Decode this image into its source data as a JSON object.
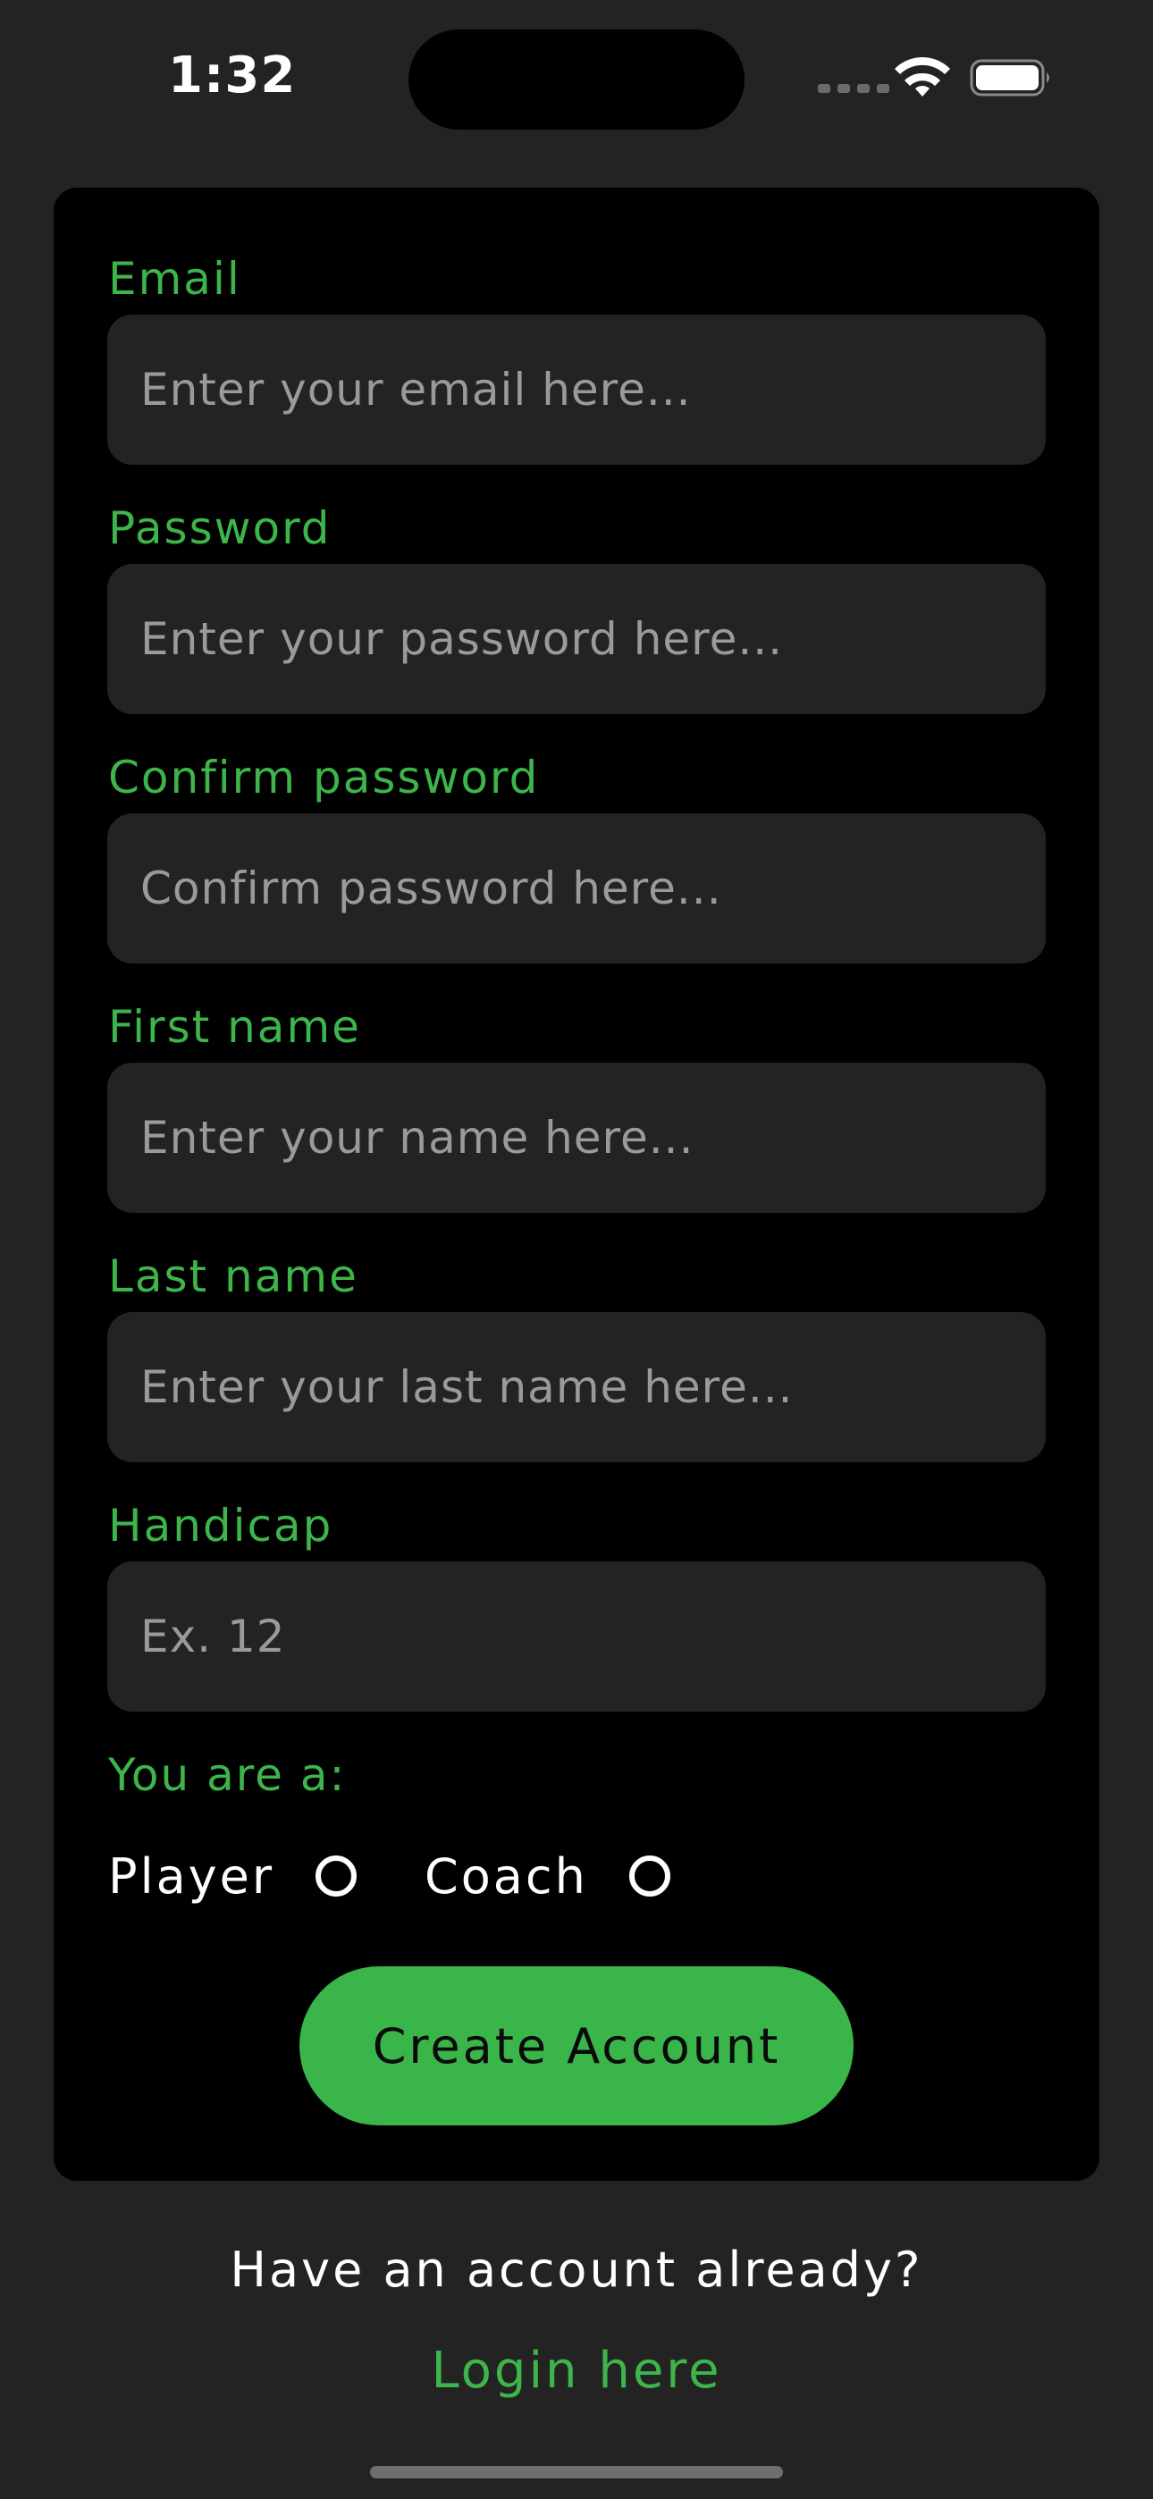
{
  "status_bar": {
    "time": "1:32"
  },
  "form": {
    "email": {
      "label": "Email",
      "placeholder": "Enter your email here...",
      "value": ""
    },
    "password": {
      "label": "Password",
      "placeholder": "Enter your password here...",
      "value": ""
    },
    "confirm_password": {
      "label": "Confirm password",
      "placeholder": "Confirm password here...",
      "value": ""
    },
    "first_name": {
      "label": "First name",
      "placeholder": "Enter your name here...",
      "value": ""
    },
    "last_name": {
      "label": "Last name",
      "placeholder": "Enter your last name here...",
      "value": ""
    },
    "handicap": {
      "label": "Handicap",
      "placeholder": "Ex. 12",
      "value": ""
    },
    "role": {
      "label": "You are a:",
      "options": [
        "Player",
        "Coach"
      ],
      "selected": null
    },
    "submit_label": "Create Account"
  },
  "footer": {
    "prompt": "Have an account already?",
    "login_label": "Login here"
  },
  "colors": {
    "background": "#232323",
    "card": "#000000",
    "input": "#232323",
    "accent": "#3db54a",
    "button": "#39b54a",
    "text": "#ffffff",
    "placeholder": "#9a9a9a"
  },
  "icons": {
    "wifi": "wifi-icon",
    "battery": "battery-icon",
    "signal": "cellular-signal-icon"
  }
}
